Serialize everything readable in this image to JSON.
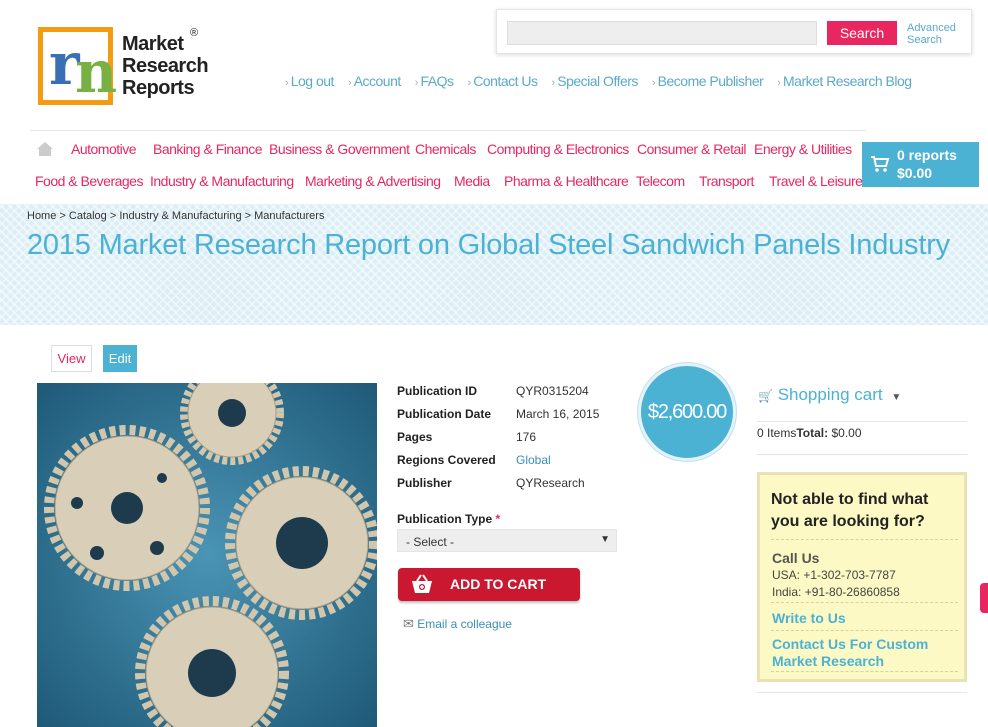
{
  "logo": {
    "lines": [
      "Market",
      "Research",
      "Reports"
    ],
    "reg": "®"
  },
  "search": {
    "placeholder": "",
    "button": "Search",
    "advanced": "Advanced Search"
  },
  "top_links": [
    "Log out",
    "Account",
    "FAQs",
    "Contact Us",
    "Special Offers",
    "Become Publisher",
    "Market Research Blog"
  ],
  "categories_row1": [
    "Automotive",
    "Banking & Finance",
    "Business & Government",
    "Chemicals",
    "Computing & Electronics",
    "Consumer & Retail",
    "Energy & Utilities"
  ],
  "categories_row2": [
    "Food & Beverages",
    "Industry & Manufacturing",
    "Marketing & Advertising",
    "Media",
    "Pharma & Healthcare",
    "Telecom",
    "Transport",
    "Travel & Leisure"
  ],
  "cart": {
    "reports": "0 reports",
    "amount": "$0.00"
  },
  "breadcrumb": "Home > Catalog > Industry & Manufacturing > Manufacturers",
  "title": "2015 Market Research Report on Global Steel Sandwich Panels Industry",
  "tabs": {
    "view": "View",
    "edit": "Edit"
  },
  "details": [
    {
      "label": "Publication ID",
      "value": "QYR0315204"
    },
    {
      "label": "Publication Date",
      "value": "March 16, 2015"
    },
    {
      "label": "Pages",
      "value": "176"
    },
    {
      "label": "Regions Covered",
      "value": "Global"
    },
    {
      "label": "Publisher",
      "value": "QYResearch"
    }
  ],
  "publication_type": {
    "label": "Publication Type",
    "required": "*",
    "selected": "- Select -"
  },
  "add_to_cart": "ADD TO CART",
  "email_colleague": "Email a colleague",
  "price": "$2,600.00",
  "shopping_cart": {
    "title": "Shopping cart",
    "items": "0 Items",
    "total_label": "Total:",
    "total": "$0.00"
  },
  "help": {
    "heading": "Not able to find what you are looking for?",
    "call_us": "Call Us",
    "usa": "USA: +1-302-703-7787",
    "india": "India: +91-80-26860858",
    "write": "Write to Us",
    "custom": "Contact Us For Custom Market Research"
  },
  "colors": {
    "accent_blue": "#4bb2d4",
    "accent_pink": "#e8265f",
    "cart_red": "#c9182f"
  }
}
